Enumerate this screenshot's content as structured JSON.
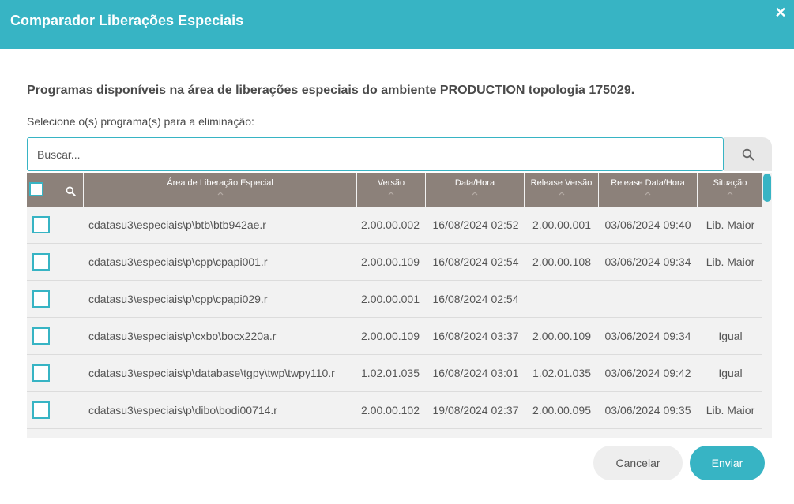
{
  "dialog": {
    "title": "Comparador Liberações Especiais",
    "close_icon": "close-icon"
  },
  "intro": "Programas disponíveis na área de liberações especiais do ambiente PRODUCTION topologia 175029.",
  "subtitle": "Selecione o(s) programa(s) para a eliminação:",
  "search": {
    "placeholder": "Buscar...",
    "value": "",
    "icon": "search-icon"
  },
  "table": {
    "columns": [
      "Área de Liberação Especial",
      "Versão",
      "Data/Hora",
      "Release Versão",
      "Release Data/Hora",
      "Situação"
    ],
    "rows": [
      {
        "area": "cdatasu3\\especiais\\p\\btb\\btb942ae.r",
        "versao": "2.00.00.002",
        "data_hora": "16/08/2024 02:52",
        "release_versao": "2.00.00.001",
        "release_data_hora": "03/06/2024 09:40",
        "situacao": "Lib. Maior"
      },
      {
        "area": "cdatasu3\\especiais\\p\\cpp\\cpapi001.r",
        "versao": "2.00.00.109",
        "data_hora": "16/08/2024 02:54",
        "release_versao": "2.00.00.108",
        "release_data_hora": "03/06/2024 09:34",
        "situacao": "Lib. Maior"
      },
      {
        "area": "cdatasu3\\especiais\\p\\cpp\\cpapi029.r",
        "versao": "2.00.00.001",
        "data_hora": "16/08/2024 02:54",
        "release_versao": "",
        "release_data_hora": "",
        "situacao": ""
      },
      {
        "area": "cdatasu3\\especiais\\p\\cxbo\\bocx220a.r",
        "versao": "2.00.00.109",
        "data_hora": "16/08/2024 03:37",
        "release_versao": "2.00.00.109",
        "release_data_hora": "03/06/2024 09:34",
        "situacao": "Igual"
      },
      {
        "area": "cdatasu3\\especiais\\p\\database\\tgpy\\twp\\twpy110.r",
        "versao": "1.02.01.035",
        "data_hora": "16/08/2024 03:01",
        "release_versao": "1.02.01.035",
        "release_data_hora": "03/06/2024 09:42",
        "situacao": "Igual"
      },
      {
        "area": "cdatasu3\\especiais\\p\\dibo\\bodi00714.r",
        "versao": "2.00.00.102",
        "data_hora": "19/08/2024 02:37",
        "release_versao": "2.00.00.095",
        "release_data_hora": "03/06/2024 09:35",
        "situacao": "Lib. Maior"
      }
    ]
  },
  "buttons": {
    "cancel": "Cancelar",
    "send": "Enviar"
  },
  "colors": {
    "accent": "#37b4c4",
    "header_bg": "#8c817a"
  }
}
